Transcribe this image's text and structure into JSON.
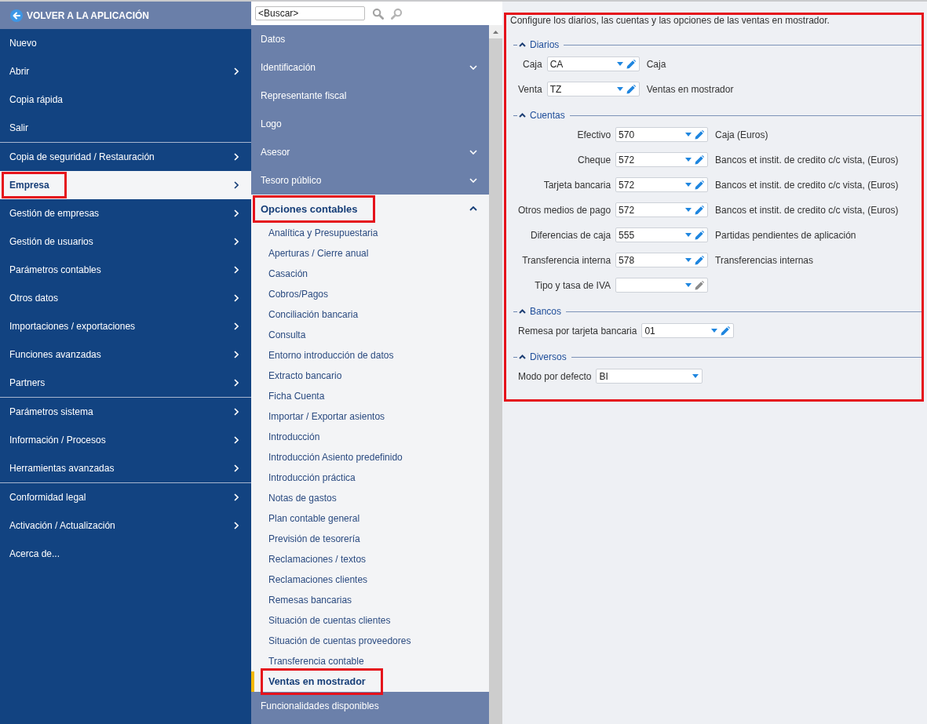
{
  "back_link": {
    "label": "VOLVER A LA APLICACIÓN"
  },
  "sidebar": {
    "groups": [
      {
        "items": [
          {
            "label": "Nuevo",
            "arrow": false,
            "selected": false,
            "highlighted": false
          },
          {
            "label": "Abrir",
            "arrow": true,
            "selected": false,
            "highlighted": false
          },
          {
            "label": "Copia rápida",
            "arrow": false,
            "selected": false,
            "highlighted": false
          },
          {
            "label": "Salir",
            "arrow": false,
            "selected": false,
            "highlighted": false
          }
        ]
      },
      {
        "items": [
          {
            "label": "Copia de seguridad / Restauración",
            "arrow": true,
            "selected": false,
            "highlighted": false
          },
          {
            "label": "Empresa",
            "arrow": true,
            "selected": true,
            "highlighted": true
          },
          {
            "label": "Gestión de empresas",
            "arrow": true,
            "selected": false,
            "highlighted": false
          },
          {
            "label": "Gestión de usuarios",
            "arrow": true,
            "selected": false,
            "highlighted": false
          },
          {
            "label": "Parámetros contables",
            "arrow": true,
            "selected": false,
            "highlighted": false
          },
          {
            "label": "Otros datos",
            "arrow": true,
            "selected": false,
            "highlighted": false
          },
          {
            "label": "Importaciones / exportaciones",
            "arrow": true,
            "selected": false,
            "highlighted": false
          },
          {
            "label": "Funciones avanzadas",
            "arrow": true,
            "selected": false,
            "highlighted": false
          },
          {
            "label": "Partners",
            "arrow": true,
            "selected": false,
            "highlighted": false
          }
        ]
      },
      {
        "items": [
          {
            "label": "Parámetros sistema",
            "arrow": true,
            "selected": false,
            "highlighted": false
          },
          {
            "label": "Información / Procesos",
            "arrow": true,
            "selected": false,
            "highlighted": false
          },
          {
            "label": "Herramientas avanzadas",
            "arrow": true,
            "selected": false,
            "highlighted": false
          }
        ]
      },
      {
        "items": [
          {
            "label": "Conformidad legal",
            "arrow": true,
            "selected": false,
            "highlighted": false
          },
          {
            "label": "Activación / Actualización",
            "arrow": true,
            "selected": false,
            "highlighted": false
          },
          {
            "label": "Acerca de...",
            "arrow": false,
            "selected": false,
            "highlighted": false
          }
        ]
      }
    ]
  },
  "search": {
    "placeholder": "<Buscar>"
  },
  "menu": {
    "items": [
      {
        "label": "Datos",
        "kind": "leaf",
        "highlighted": false
      },
      {
        "label": "Identificación",
        "kind": "folder",
        "expanded": false,
        "highlighted": false
      },
      {
        "label": "Representante fiscal",
        "kind": "leaf",
        "highlighted": false
      },
      {
        "label": "Logo",
        "kind": "leaf",
        "highlighted": false
      },
      {
        "label": "Asesor",
        "kind": "folder",
        "expanded": false,
        "highlighted": false
      },
      {
        "label": "Tesoro público",
        "kind": "folder",
        "expanded": false,
        "highlighted": false
      },
      {
        "label": "Opciones contables",
        "kind": "folder",
        "expanded": true,
        "highlighted": true,
        "children": [
          {
            "label": "Analítica y Presupuestaria",
            "selected": false,
            "highlighted": false
          },
          {
            "label": "Aperturas / Cierre anual",
            "selected": false,
            "highlighted": false
          },
          {
            "label": "Casación",
            "selected": false,
            "highlighted": false
          },
          {
            "label": "Cobros/Pagos",
            "selected": false,
            "highlighted": false
          },
          {
            "label": "Conciliación bancaria",
            "selected": false,
            "highlighted": false
          },
          {
            "label": "Consulta",
            "selected": false,
            "highlighted": false
          },
          {
            "label": "Entorno introducción de datos",
            "selected": false,
            "highlighted": false
          },
          {
            "label": "Extracto bancario",
            "selected": false,
            "highlighted": false
          },
          {
            "label": "Ficha Cuenta",
            "selected": false,
            "highlighted": false
          },
          {
            "label": "Importar / Exportar asientos",
            "selected": false,
            "highlighted": false
          },
          {
            "label": "Introducción",
            "selected": false,
            "highlighted": false
          },
          {
            "label": "Introducción Asiento predefinido",
            "selected": false,
            "highlighted": false
          },
          {
            "label": "Introducción práctica",
            "selected": false,
            "highlighted": false
          },
          {
            "label": "Notas de gastos",
            "selected": false,
            "highlighted": false
          },
          {
            "label": "Plan contable general",
            "selected": false,
            "highlighted": false
          },
          {
            "label": "Previsión de tesorería",
            "selected": false,
            "highlighted": false
          },
          {
            "label": "Reclamaciones / textos",
            "selected": false,
            "highlighted": false
          },
          {
            "label": "Reclamaciones clientes",
            "selected": false,
            "highlighted": false
          },
          {
            "label": "Remesas bancarias",
            "selected": false,
            "highlighted": false
          },
          {
            "label": "Situación de cuentas clientes",
            "selected": false,
            "highlighted": false
          },
          {
            "label": "Situación de cuentas proveedores",
            "selected": false,
            "highlighted": false
          },
          {
            "label": "Transferencia contable",
            "selected": false,
            "highlighted": false
          },
          {
            "label": "Ventas en mostrador",
            "selected": true,
            "highlighted": true
          }
        ]
      },
      {
        "label": "Funcionalidades disponibles",
        "kind": "leaf",
        "highlighted": false
      }
    ]
  },
  "settings": {
    "highlighted": true,
    "intro": "Configure los diarios, las cuentas y las opciones de las ventas en mostrador.",
    "sections": [
      {
        "title": "Diarios",
        "expanded": true,
        "fields": [
          {
            "kind": "lookup",
            "label": "Caja",
            "value": "CA",
            "description": "Caja",
            "edit_enabled": true
          },
          {
            "kind": "lookup",
            "label": "Venta",
            "value": "TZ",
            "description": "Ventas en mostrador",
            "edit_enabled": true
          }
        ]
      },
      {
        "title": "Cuentas",
        "expanded": true,
        "fields": [
          {
            "kind": "lookup",
            "label": "Efectivo",
            "value": "570",
            "description": "Caja (Euros)",
            "edit_enabled": true
          },
          {
            "kind": "lookup",
            "label": "Cheque",
            "value": "572",
            "description": "Bancos et instit. de credito c/c vista, (Euros)",
            "edit_enabled": true
          },
          {
            "kind": "lookup",
            "label": "Tarjeta bancaria",
            "value": "572",
            "description": "Bancos et instit. de credito c/c vista, (Euros)",
            "edit_enabled": true
          },
          {
            "kind": "lookup",
            "label": "Otros medios de pago",
            "value": "572",
            "description": "Bancos et instit. de credito c/c vista, (Euros)",
            "edit_enabled": true
          },
          {
            "kind": "lookup",
            "label": "Diferencias de caja",
            "value": "555",
            "description": "Partidas pendientes de aplicación",
            "edit_enabled": true
          },
          {
            "kind": "lookup",
            "label": "Transferencia interna",
            "value": "578",
            "description": "Transferencias internas",
            "edit_enabled": true
          },
          {
            "kind": "lookup",
            "label": "Tipo y tasa de IVA",
            "edit_enabled": false
          }
        ]
      },
      {
        "title": "Bancos",
        "expanded": true,
        "fields": [
          {
            "kind": "lookup",
            "label": "Remesa por tarjeta bancaria",
            "value": "01",
            "edit_enabled": true
          }
        ]
      },
      {
        "title": "Diversos",
        "expanded": true,
        "fields": [
          {
            "kind": "select",
            "label": "Modo por defecto",
            "value": "BI"
          }
        ]
      }
    ]
  }
}
